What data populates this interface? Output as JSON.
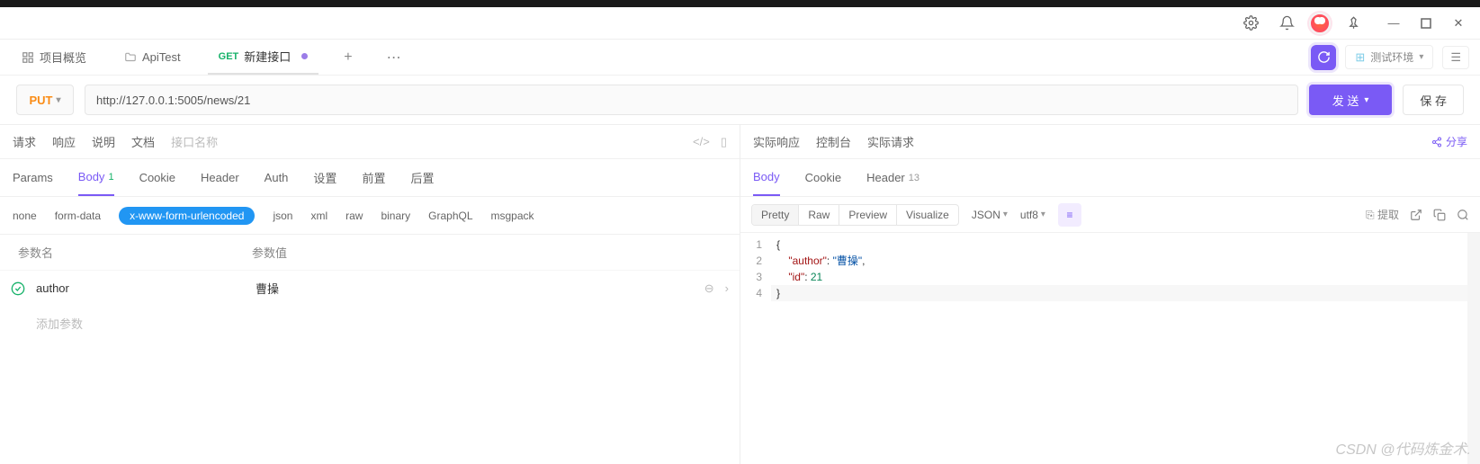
{
  "titlebar": {
    "settings_icon": "settings",
    "notif_icon": "bell",
    "pin_icon": "pin"
  },
  "tabs": {
    "overview": "项目概览",
    "apitest": "ApiTest",
    "current_method": "GET",
    "current_label": "新建接口"
  },
  "env": {
    "label": "测试环境"
  },
  "request": {
    "method": "PUT",
    "url": "http://127.0.0.1:5005/news/21",
    "send": "发 送",
    "save": "保 存"
  },
  "left": {
    "sub": {
      "req": "请求",
      "resp": "响应",
      "doc": "说明",
      "docs": "文档",
      "placeholder": "接口名称"
    },
    "hdr": {
      "params": "Params",
      "body": "Body",
      "body_count": "1",
      "cookie": "Cookie",
      "header": "Header",
      "auth": "Auth",
      "setting": "设置",
      "pre": "前置",
      "post": "后置"
    },
    "types": {
      "none": "none",
      "form": "form-data",
      "xwww": "x-www-form-urlencoded",
      "json": "json",
      "xml": "xml",
      "raw": "raw",
      "binary": "binary",
      "gql": "GraphQL",
      "msgpack": "msgpack"
    },
    "param_head": {
      "name": "参数名",
      "value": "参数值"
    },
    "rows": [
      {
        "name": "author",
        "value": "曹操"
      }
    ],
    "add": "添加参数"
  },
  "right": {
    "sub": {
      "actual_resp": "实际响应",
      "console": "控制台",
      "actual_req": "实际请求"
    },
    "share": "分享",
    "hdr": {
      "body": "Body",
      "cookie": "Cookie",
      "header": "Header",
      "header_count": "13"
    },
    "toolbar": {
      "pretty": "Pretty",
      "raw": "Raw",
      "preview": "Preview",
      "visualize": "Visualize",
      "fmt": "JSON",
      "enc": "utf8",
      "extract": "提取"
    },
    "code": {
      "lines": [
        "1",
        "2",
        "3",
        "4"
      ],
      "l2_key": "\"author\"",
      "l2_val": "\"曹操\"",
      "l3_key": "\"id\"",
      "l3_val": "21"
    }
  },
  "watermark": "CSDN @代码炼金术."
}
